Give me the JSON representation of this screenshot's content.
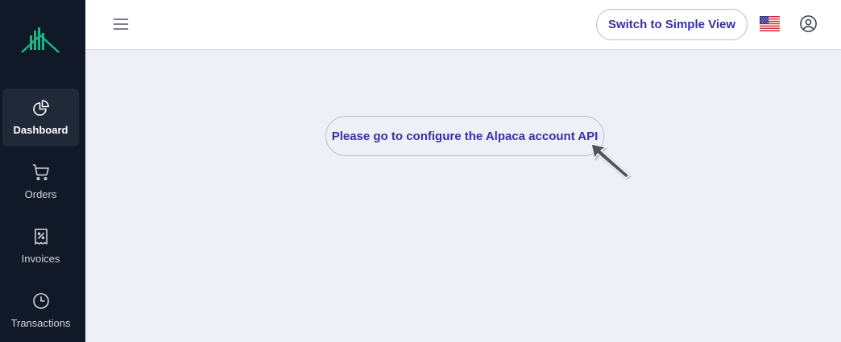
{
  "sidebar": {
    "logo_icon": "chart-bars-logo",
    "items": [
      {
        "label": "Dashboard",
        "icon": "pie-chart-icon",
        "active": true
      },
      {
        "label": "Orders",
        "icon": "shopping-cart-icon",
        "active": false
      },
      {
        "label": "Invoices",
        "icon": "receipt-percent-icon",
        "active": false
      },
      {
        "label": "Transactions",
        "icon": "clock-icon",
        "active": false
      }
    ]
  },
  "header": {
    "menu_icon": "hamburger-menu-icon",
    "switch_view_label": "Switch to Simple View",
    "language_flag": "us-flag-icon",
    "user_icon": "user-circle-icon"
  },
  "main": {
    "message": "Please go to configure the Alpaca account API"
  },
  "colors": {
    "sidebar_bg": "#111827",
    "sidebar_active_bg": "#1f2937",
    "accent_text": "#3730a3",
    "content_bg": "#eef0f8",
    "logo_green": "#1db584"
  }
}
